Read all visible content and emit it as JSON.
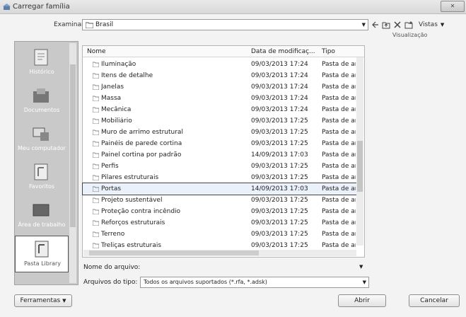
{
  "window": {
    "title": "Carregar família",
    "close": "✕"
  },
  "lookin": {
    "label": "Examinar:",
    "value": "Brasil"
  },
  "toolbar": {
    "views_label": "Vistas",
    "preview_label": "Visualização"
  },
  "places": [
    {
      "label": "Histórico"
    },
    {
      "label": "Documentos"
    },
    {
      "label": "Meu computador"
    },
    {
      "label": "Favoritos"
    },
    {
      "label": "Área de trabalho"
    },
    {
      "label": "Pasta Library"
    }
  ],
  "list": {
    "headers": {
      "name": "Nome",
      "date": "Data de modificaç...",
      "type": "Tipo"
    },
    "rows": [
      {
        "name": "Iluminação",
        "date": "09/03/2013 17:24",
        "type": "Pasta de ar"
      },
      {
        "name": "Itens de detalhe",
        "date": "09/03/2013 17:24",
        "type": "Pasta de ar"
      },
      {
        "name": "Janelas",
        "date": "09/03/2013 17:24",
        "type": "Pasta de ar"
      },
      {
        "name": "Massa",
        "date": "09/03/2013 17:24",
        "type": "Pasta de ar"
      },
      {
        "name": "Mecânica",
        "date": "09/03/2013 17:24",
        "type": "Pasta de ar"
      },
      {
        "name": "Mobiliário",
        "date": "09/03/2013 17:25",
        "type": "Pasta de ar"
      },
      {
        "name": "Muro de arrimo estrutural",
        "date": "09/03/2013 17:25",
        "type": "Pasta de ar"
      },
      {
        "name": "Painéis de parede cortina",
        "date": "09/03/2013 17:25",
        "type": "Pasta de ar"
      },
      {
        "name": "Painel cortina por padrão",
        "date": "14/09/2013 17:03",
        "type": "Pasta de ar"
      },
      {
        "name": "Perfis",
        "date": "09/03/2013 17:25",
        "type": "Pasta de ar"
      },
      {
        "name": "Pilares estruturais",
        "date": "09/03/2013 17:25",
        "type": "Pasta de ar"
      },
      {
        "name": "Portas",
        "date": "14/09/2013 17:03",
        "type": "Pasta de ar"
      },
      {
        "name": "Projeto sustentável",
        "date": "09/03/2013 17:25",
        "type": "Pasta de ar"
      },
      {
        "name": "Proteção contra incêndio",
        "date": "09/03/2013 17:25",
        "type": "Pasta de ar"
      },
      {
        "name": "Reforços estruturais",
        "date": "09/03/2013 17:25",
        "type": "Pasta de ar"
      },
      {
        "name": "Terreno",
        "date": "09/03/2013 17:25",
        "type": "Pasta de ar"
      },
      {
        "name": "Treliças estruturais",
        "date": "09/03/2013 17:25",
        "type": "Pasta de ar"
      }
    ],
    "selected_index": 11
  },
  "filename": {
    "label": "Nome do arquivo:",
    "value": ""
  },
  "filetype": {
    "label": "Arquivos do tipo:",
    "value": "Todos os arquivos suportados (*.rfa, *.adsk)"
  },
  "buttons": {
    "tools": "Ferramentas",
    "open": "Abrir",
    "cancel": "Cancelar"
  }
}
